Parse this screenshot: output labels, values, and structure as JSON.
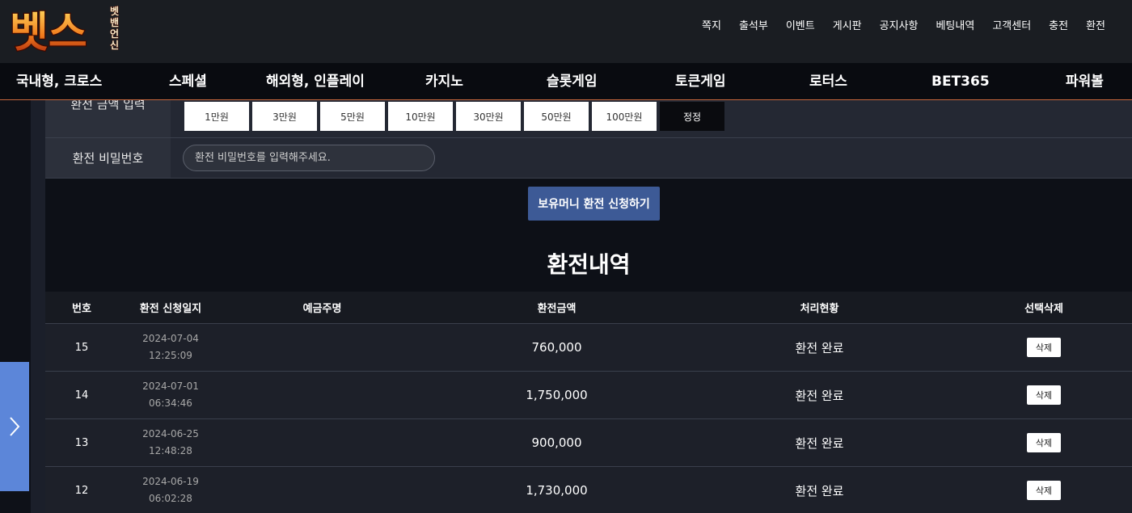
{
  "logo": {
    "main_text": "벳스",
    "side_text": [
      "벳",
      "밴",
      "언",
      "신"
    ]
  },
  "top_menu": [
    "쪽지",
    "출석부",
    "이벤트",
    "게시판",
    "공지사항",
    "베팅내역",
    "고객센터",
    "충전",
    "환전"
  ],
  "game_nav": [
    "국내형, 크로스",
    "스페셜",
    "해외형, 인플레이",
    "카지노",
    "슬롯게임",
    "토큰게임",
    "로터스",
    "BET365",
    "파워볼"
  ],
  "form": {
    "amount_label": "환전 금액 입력",
    "amount_buttons": [
      "1만원",
      "3만원",
      "5만원",
      "10만원",
      "30만원",
      "50만원",
      "100만원"
    ],
    "reset_label": "정정",
    "password_label": "환전 비밀번호",
    "password_placeholder": "환전 비밀번호를 입력해주세요.",
    "submit_label": "보유머니 환전 신청하기"
  },
  "history": {
    "title": "환전내역",
    "columns": [
      "번호",
      "환전 신청일지",
      "예금주명",
      "환전금액",
      "처리현황",
      "선택삭제"
    ],
    "delete_label": "삭제",
    "rows": [
      {
        "no": "15",
        "date": "2024-07-04",
        "time": "12:25:09",
        "holder": "",
        "amount": "760,000",
        "status": "환전 완료"
      },
      {
        "no": "14",
        "date": "2024-07-01",
        "time": "06:34:46",
        "holder": "",
        "amount": "1,750,000",
        "status": "환전 완료"
      },
      {
        "no": "13",
        "date": "2024-06-25",
        "time": "12:48:28",
        "holder": "",
        "amount": "900,000",
        "status": "환전 완료"
      },
      {
        "no": "12",
        "date": "2024-06-19",
        "time": "06:02:28",
        "holder": "",
        "amount": "1,730,000",
        "status": "환전 완료"
      }
    ]
  },
  "colors": {
    "accent_blue": "#3d5a96",
    "side_toggle": "#5c86d9",
    "nav_border": "#c7673d"
  },
  "icons": {
    "side_toggle": "chevron-right-icon"
  }
}
